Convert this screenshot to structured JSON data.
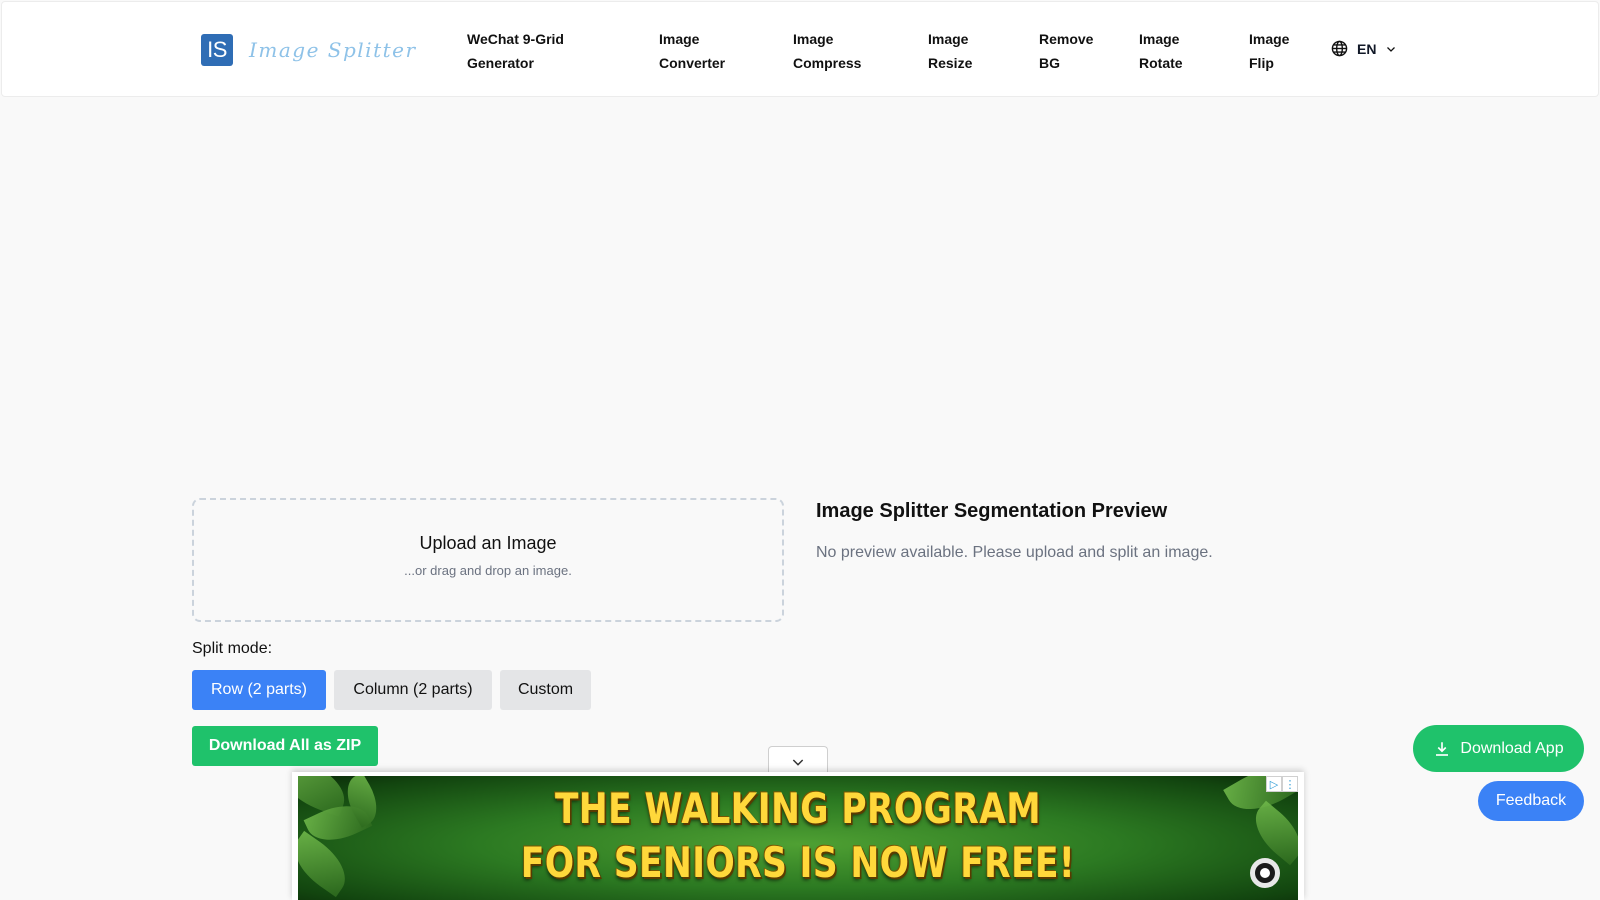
{
  "header": {
    "logo_badge": "IS",
    "logo_text": "Image Splitter",
    "nav": [
      {
        "line1": "WeChat 9-Grid",
        "line2": "Generator"
      },
      {
        "line1": "Image",
        "line2": "Converter"
      },
      {
        "line1": "Image",
        "line2": "Compress"
      },
      {
        "line1": "Image",
        "line2": "Resize"
      },
      {
        "line1": "Remove",
        "line2": "BG"
      },
      {
        "line1": "Image",
        "line2": "Rotate"
      },
      {
        "line1": "Image",
        "line2": "Flip"
      }
    ],
    "language": "EN"
  },
  "upload": {
    "title": "Upload an Image",
    "subtitle": "...or drag and drop an image."
  },
  "split": {
    "label": "Split mode:",
    "modes": [
      {
        "label": "Row (2 parts)",
        "active": true
      },
      {
        "label": "Column (2 parts)",
        "active": false
      },
      {
        "label": "Custom",
        "active": false
      }
    ],
    "download_zip": "Download All as ZIP"
  },
  "preview": {
    "title": "Image Splitter Segmentation Preview",
    "empty_message": "No preview available. Please upload and split an image."
  },
  "floating": {
    "download_app": "Download App",
    "feedback": "Feedback"
  },
  "ad": {
    "line1": "THE WALKING PROGRAM",
    "line2": "FOR SENIORS IS NOW FREE!"
  },
  "colors": {
    "primary_blue": "#3b82f6",
    "green": "#1fc26b",
    "logo_blue": "#2f6db5",
    "page_bg": "#f9f9f9",
    "ad_text": "#ffd83b"
  }
}
